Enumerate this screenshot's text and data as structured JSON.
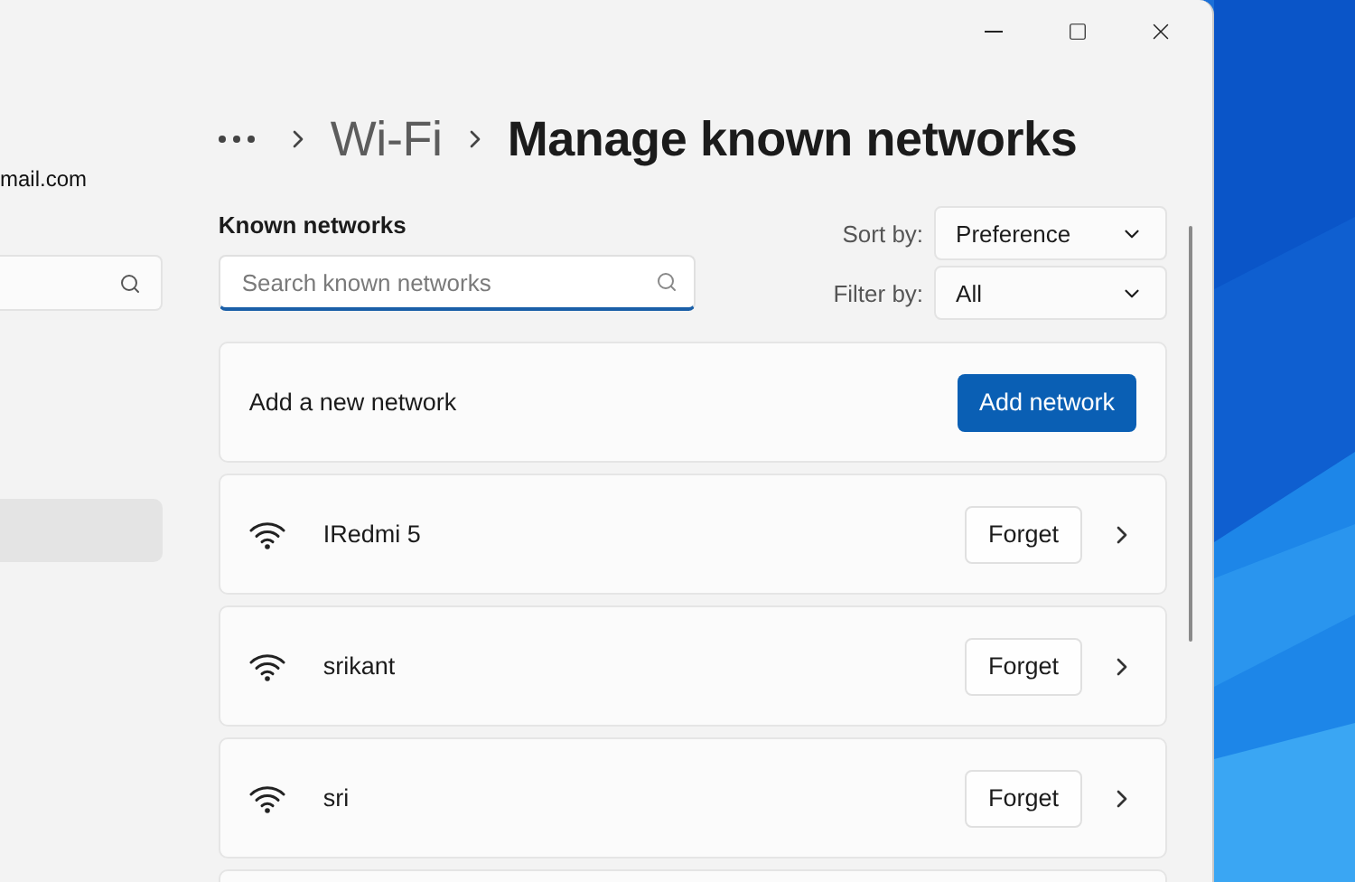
{
  "sidebar": {
    "account_email": "mail.com",
    "nav_items": [
      {
        "selected": true
      }
    ]
  },
  "breadcrumb": [
    {
      "label": "Wi-Fi",
      "current": false
    },
    {
      "label": "Manage known networks",
      "current": true
    }
  ],
  "known_networks": {
    "heading": "Known networks",
    "search": {
      "placeholder": "Search known networks",
      "focused": true
    },
    "sort": {
      "label": "Sort by:",
      "value": "Preference"
    },
    "filter": {
      "label": "Filter by:",
      "value": "All"
    },
    "add": {
      "text": "Add a new network",
      "button": "Add network"
    },
    "networks": [
      {
        "name": "IRedmi 5",
        "action": "Forget"
      },
      {
        "name": "srikant",
        "action": "Forget"
      },
      {
        "name": "sri",
        "action": "Forget"
      }
    ]
  }
}
